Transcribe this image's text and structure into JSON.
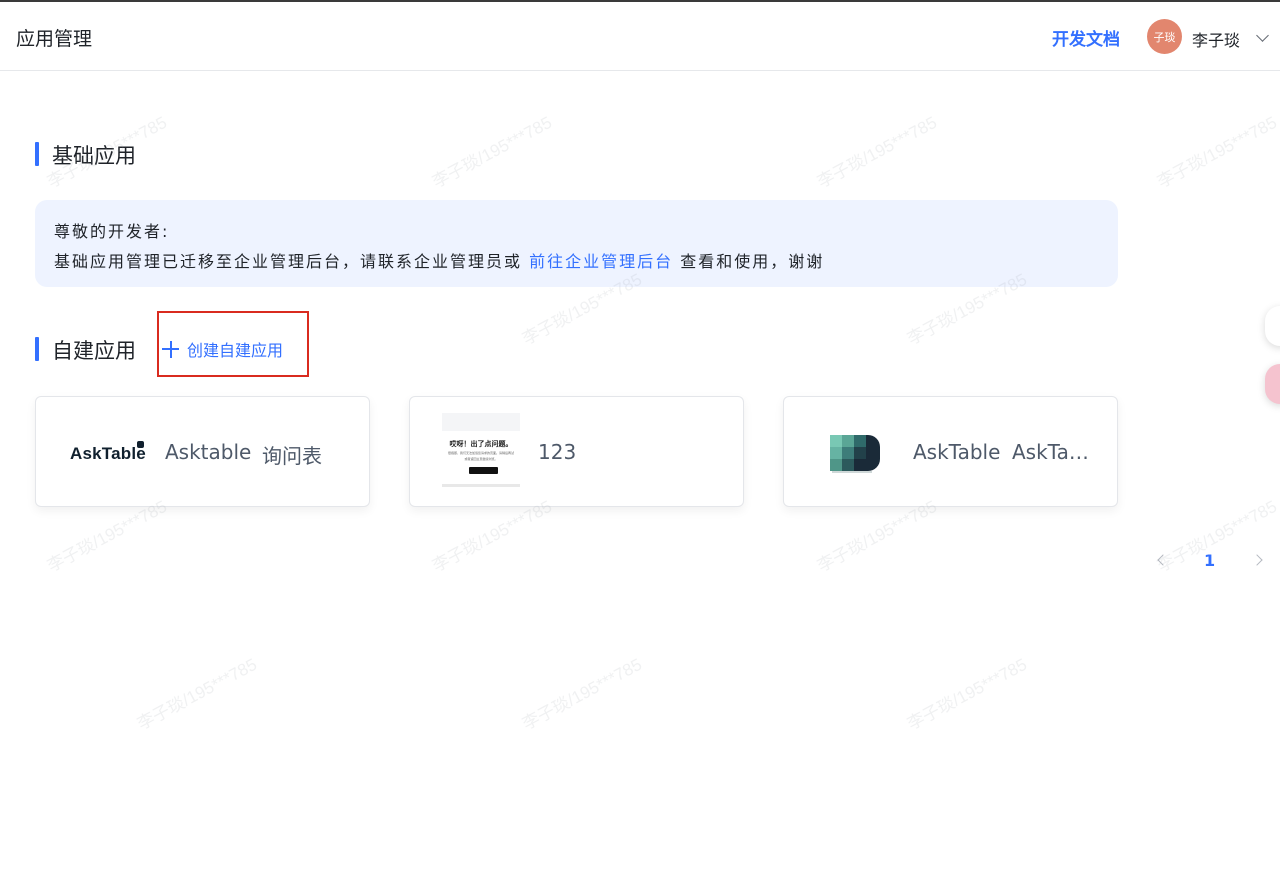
{
  "header": {
    "title": "应用管理",
    "docs_link": "开发文档",
    "user": {
      "avatar_text": "子琰",
      "name": "李子琰"
    }
  },
  "basic_apps": {
    "title": "基础应用",
    "notice": {
      "greeting": "尊敬的开发者:",
      "text_before": "基础应用管理已迁移至企业管理后台，请联系企业管理员或",
      "link": "前往企业管理后台",
      "text_after": "查看和使用，谢谢"
    }
  },
  "custom_apps": {
    "title": "自建应用",
    "create_label": "创建自建应用",
    "cards": [
      {
        "logo_text": "AskTable",
        "name": "Asktable",
        "desc": "询问表"
      },
      {
        "thumb_title": "哎呀！出了点问题。",
        "thumb_line1": "很抱歉，我们无法加载您请求的页面。请稍后再试",
        "thumb_line2": "或者返回主页继续浏览。",
        "name": "123"
      },
      {
        "name": "AskTable",
        "desc": "AskTab..."
      }
    ]
  },
  "pagination": {
    "current": "1"
  },
  "watermark": "李子琰/195***785",
  "colors": {
    "accent": "#3370ff",
    "highlight_box": "#d92b1f",
    "avatar": "#e2866e"
  }
}
